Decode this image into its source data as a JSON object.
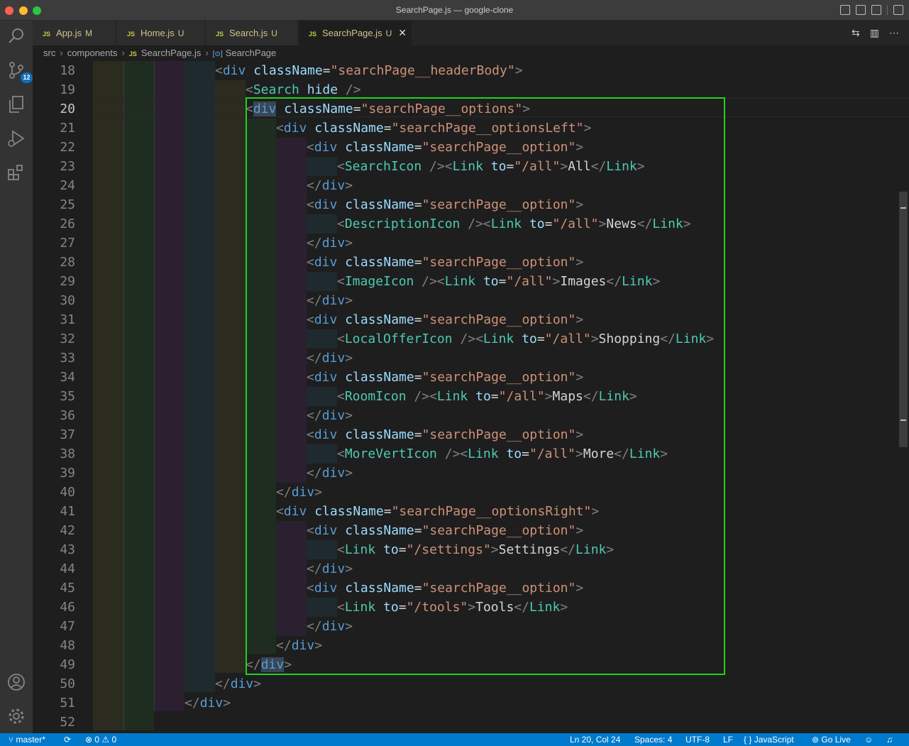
{
  "window": {
    "title": "SearchPage.js — google-clone"
  },
  "activity": {
    "scm_badge": "12"
  },
  "tabs": [
    {
      "label": "App.js",
      "status": "M",
      "type": "JS"
    },
    {
      "label": "Home.js",
      "status": "U",
      "type": "JS"
    },
    {
      "label": "Search.js",
      "status": "U",
      "type": "JS"
    },
    {
      "label": "SearchPage.js",
      "status": "U",
      "type": "JS",
      "close": "✕"
    }
  ],
  "breadcrumb": {
    "folder1": "src",
    "folder2": "components",
    "file": "SearchPage.js",
    "file_type": "JS",
    "symbol": "SearchPage",
    "symbol_icon": "[⊙]"
  },
  "editor": {
    "line_numbers": [
      "18",
      "19",
      "20",
      "21",
      "22",
      "23",
      "24",
      "25",
      "26",
      "27",
      "28",
      "29",
      "30",
      "31",
      "32",
      "33",
      "34",
      "35",
      "36",
      "37",
      "38",
      "39",
      "40",
      "41",
      "42",
      "43",
      "44",
      "45",
      "46",
      "47",
      "48",
      "49",
      "50",
      "51",
      "52"
    ],
    "current_line": "20"
  },
  "status": {
    "branch": "master*",
    "sync": "",
    "errors": "0",
    "warnings": "0",
    "position": "Ln 20, Col 24",
    "spaces": "Spaces: 4",
    "encoding": "UTF-8",
    "eol": "LF",
    "language": "JavaScript",
    "language_icon": "{ }",
    "golive": "Go Live"
  },
  "colors": {
    "accent": "#007acc",
    "selection_box": "#1fd31f",
    "tab_modified": "#cfc48a"
  }
}
